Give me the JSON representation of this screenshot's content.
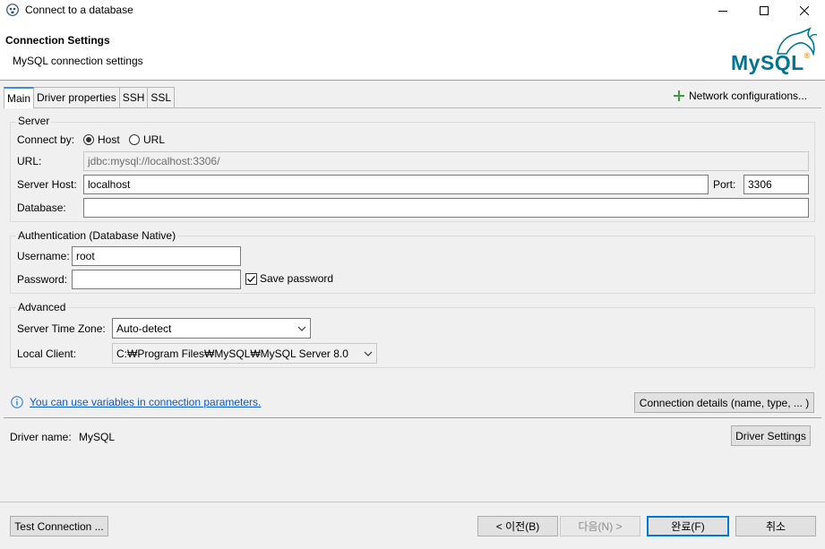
{
  "window": {
    "title": "Connect to a database",
    "icons": {
      "app": "dbeaver-beaver-icon",
      "minimize": "minimize-icon",
      "maximize": "maximize-icon",
      "close": "close-icon"
    }
  },
  "header": {
    "title": "Connection Settings",
    "subtitle": "MySQL connection settings",
    "logo_text": "MySQL",
    "logo_mark": "®"
  },
  "tabs": [
    {
      "label": "Main",
      "active": true
    },
    {
      "label": "Driver properties",
      "active": false
    },
    {
      "label": "SSH",
      "active": false
    },
    {
      "label": "SSL",
      "active": false
    }
  ],
  "network_config": {
    "label": "Network configurations...",
    "icon": "plus-icon"
  },
  "server": {
    "group_label": "Server",
    "connect_by_label": "Connect by:",
    "host_option": "Host",
    "url_option": "URL",
    "selected": "Host",
    "url_label": "URL:",
    "url_value": "jdbc:mysql://localhost:3306/",
    "host_label": "Server Host:",
    "host_value": "localhost",
    "port_label": "Port:",
    "port_value": "3306",
    "database_label": "Database:",
    "database_value": ""
  },
  "auth": {
    "group_label": "Authentication (Database Native)",
    "username_label": "Username:",
    "username_value": "root",
    "password_label": "Password:",
    "password_value": "",
    "save_password_label": "Save password",
    "save_password_checked": true
  },
  "advanced": {
    "group_label": "Advanced",
    "timezone_label": "Server Time Zone:",
    "timezone_value": "Auto-detect",
    "local_client_label": "Local Client:",
    "local_client_value": "C:₩Program Files₩MySQL₩MySQL Server 8.0"
  },
  "variables_link": "You can use variables in connection parameters.",
  "connection_details_button": "Connection details (name, type, ... )",
  "driver": {
    "name_label": "Driver name:",
    "name_value": "MySQL",
    "settings_button": "Driver Settings"
  },
  "footer": {
    "test_connection": "Test Connection ...",
    "back": "< 이전(B)",
    "next": "다음(N) >",
    "finish": "완료(F)",
    "cancel": "취소"
  },
  "colors": {
    "accent": "#0078d7",
    "link": "#0b59c5",
    "add_green": "#3f9b3f",
    "mysql_blue": "#00758f",
    "mysql_orange": "#f29111"
  }
}
